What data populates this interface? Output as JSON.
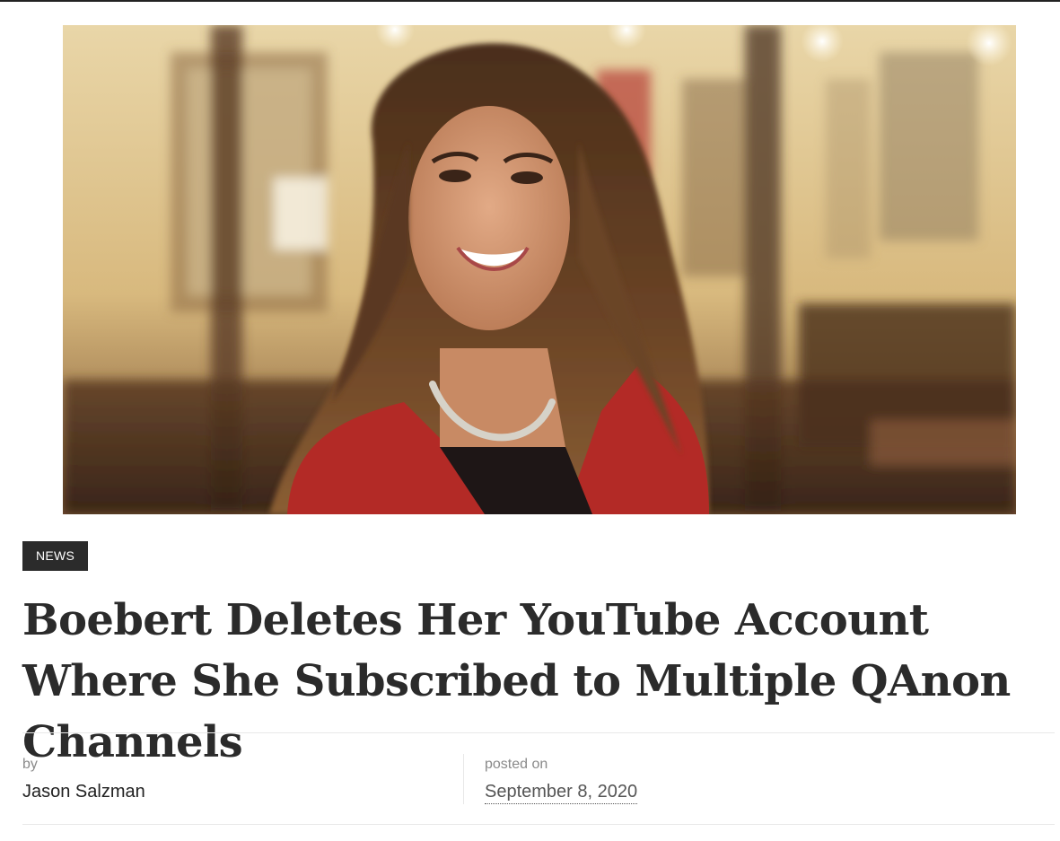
{
  "article": {
    "hero_image": "portrait-photo",
    "category": "NEWS",
    "title": "Boebert Deletes Her YouTube Account Where She Subscribed to Multiple QAnon Channels",
    "byline": {
      "author_label": "by",
      "author": "Jason Salzman",
      "date_label": "posted on",
      "date": "September 8, 2020"
    }
  },
  "colors": {
    "badge_bg": "#2b2b2b",
    "badge_text": "#ffffff",
    "headline": "#2b2b2b",
    "meta_label": "#8a8a8a",
    "divider": "#e8e8e8"
  }
}
